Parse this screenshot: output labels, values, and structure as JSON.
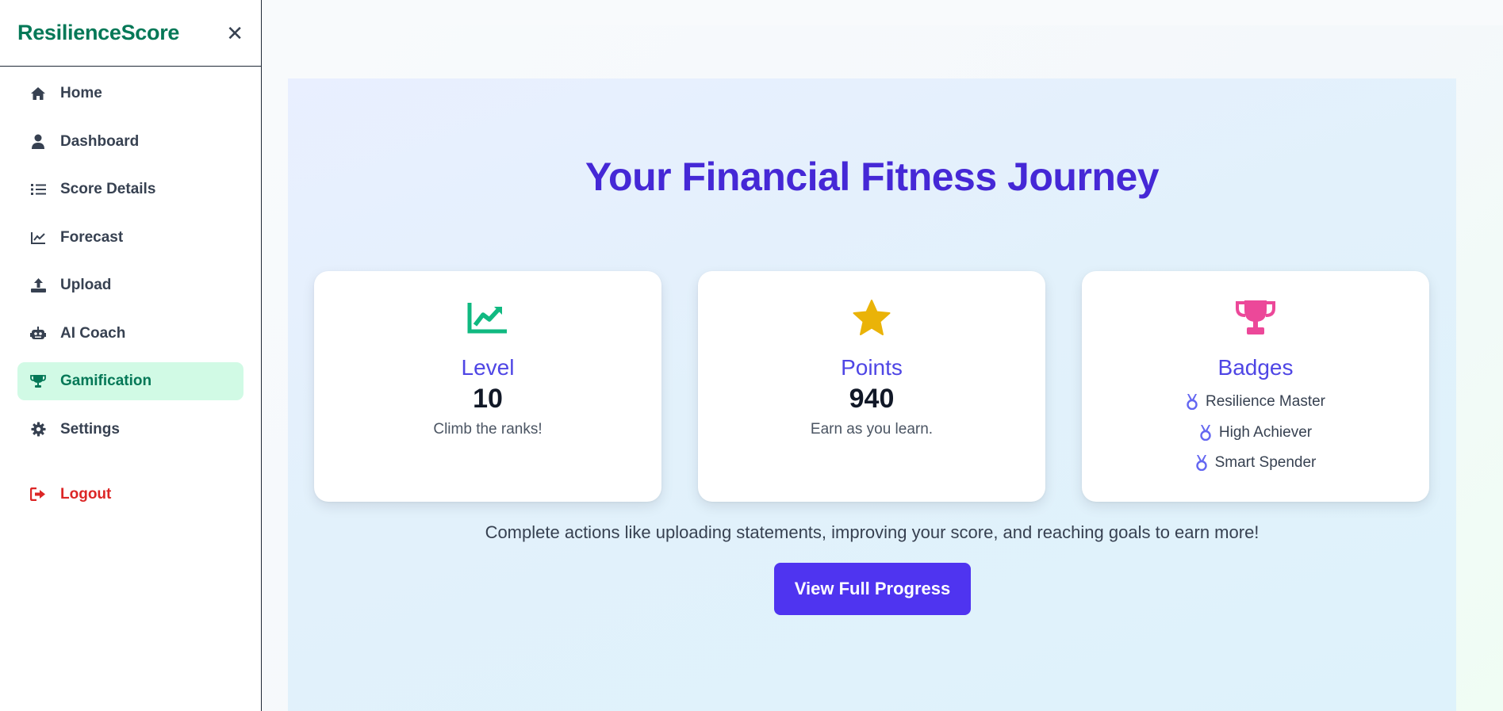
{
  "sidebar": {
    "brand": "ResilienceScore",
    "close_icon": "close-icon",
    "items": [
      {
        "label": "Home",
        "icon": "home-icon"
      },
      {
        "label": "Dashboard",
        "icon": "user-icon"
      },
      {
        "label": "Score Details",
        "icon": "list-icon"
      },
      {
        "label": "Forecast",
        "icon": "line-chart-icon"
      },
      {
        "label": "Upload",
        "icon": "upload-icon"
      },
      {
        "label": "AI Coach",
        "icon": "robot-icon"
      },
      {
        "label": "Gamification",
        "icon": "trophy-icon",
        "active": true
      },
      {
        "label": "Settings",
        "icon": "gear-icon"
      }
    ],
    "logout": {
      "label": "Logout",
      "icon": "sign-out-icon"
    }
  },
  "main": {
    "title": "Your Financial Fitness Journey",
    "cards": {
      "level": {
        "icon": "trend-up-icon",
        "label": "Level",
        "value": "10",
        "sub": "Climb the ranks!"
      },
      "points": {
        "icon": "star-icon",
        "label": "Points",
        "value": "940",
        "sub": "Earn as you learn."
      },
      "badges": {
        "icon": "trophy-icon",
        "label": "Badges",
        "items": [
          "Resilience Master",
          "High Achiever",
          "Smart Spender"
        ]
      }
    },
    "cta_text": "Complete actions like uploading statements, improving your score, and reaching goals to earn more!",
    "cta_button": "View Full Progress"
  },
  "colors": {
    "brand": "#047857",
    "accent": "#4f46e5",
    "active_bg": "#d1fae5",
    "logout": "#dc2626",
    "level_icon": "#10b981",
    "points_icon": "#eab308",
    "badges_icon": "#ec4899",
    "medal": "#6366f1",
    "button": "#4f34f0"
  }
}
